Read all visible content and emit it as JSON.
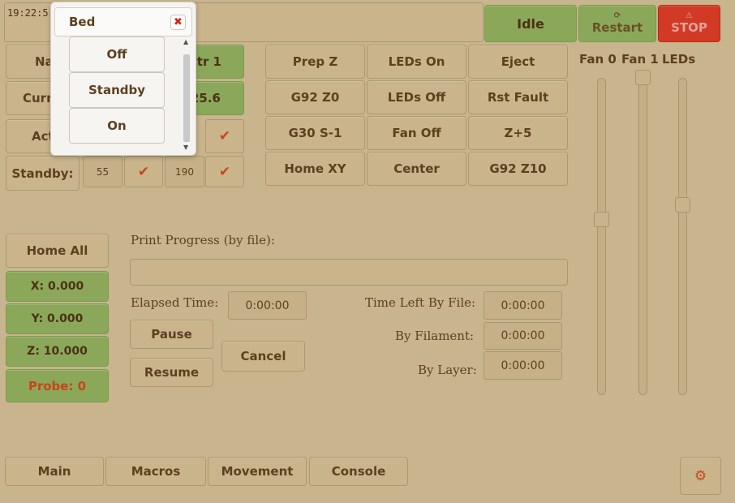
{
  "console": {
    "text": "19:22:5  Idle"
  },
  "status": {
    "label": "Idle",
    "restart_label": "Restart",
    "stop_label": "STOP",
    "restart_icon": "refresh-icon",
    "stop_icon": "warning-icon"
  },
  "heaters": {
    "name_label": "Na",
    "current_label": "Curr",
    "active_label": "Act",
    "standby_label": "Standby:",
    "extruder_header": "xtr 1",
    "extruder_current": "25.6",
    "standby_bed": "55",
    "standby_extruder": "190"
  },
  "macros": {
    "row1": [
      "Prep Z",
      "LEDs On",
      "Eject"
    ],
    "row2": [
      "G92 Z0",
      "LEDs Off",
      "Rst Fault"
    ],
    "row3": [
      "G30 S-1",
      "Fan Off",
      "Z+5"
    ],
    "row4": [
      "Home XY",
      "Center",
      "G92 Z10"
    ]
  },
  "sliders": {
    "fan0_label": "Fan 0",
    "fan1_label": "Fan 1",
    "leds_label": "LEDs"
  },
  "axes": {
    "home_all": "Home All",
    "x": "X: 0.000",
    "y": "Y: 0.000",
    "z": "Z: 10.000",
    "probe": "Probe: 0"
  },
  "progress": {
    "title": "Print Progress (by file):",
    "elapsed_label": "Elapsed Time:",
    "elapsed_value": "0:00:00",
    "time_left_file_label": "Time Left By File:",
    "time_left_file_value": "0:00:00",
    "by_filament_label": "By Filament:",
    "by_filament_value": "0:00:00",
    "by_layer_label": "By Layer:",
    "by_layer_value": "0:00:00",
    "pause": "Pause",
    "resume": "Resume",
    "cancel": "Cancel"
  },
  "tabs": [
    "Main",
    "Macros",
    "Movement",
    "Console"
  ],
  "settings_icon": "gear-icon",
  "popup": {
    "title": "Bed",
    "close_icon": "close-icon",
    "options": [
      "Off",
      "Standby",
      "On"
    ]
  },
  "colors": {
    "background": "#c8b48d",
    "green": "#8ba85a",
    "red": "#d23a25",
    "accent": "#c8451a"
  }
}
